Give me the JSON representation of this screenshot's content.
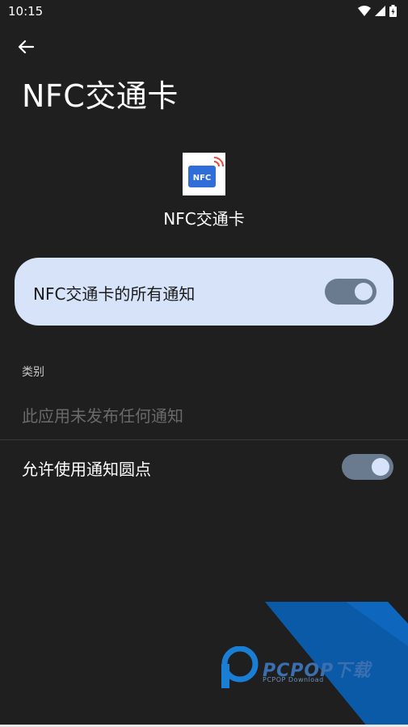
{
  "status_bar": {
    "time": "10:15",
    "icons": [
      "wifi-icon",
      "signal-icon",
      "battery-charging-icon"
    ]
  },
  "header": {
    "back_icon": "back-arrow-icon",
    "title": "NFC交通卡"
  },
  "app": {
    "icon_text": "NFC",
    "name": "NFC交通卡"
  },
  "all_notifications": {
    "label": "NFC交通卡的所有通知",
    "enabled": true
  },
  "category": {
    "heading": "类别",
    "empty_text": "此应用未发布任何通知"
  },
  "notification_dot": {
    "label": "允许使用通知圆点",
    "enabled": true
  },
  "watermark": {
    "brand": "PCPOP下载",
    "sub": "PCPOP Download"
  },
  "colors": {
    "background": "#1f1f1f",
    "card": "#d6e3f8",
    "toggle_track": "#6b7b8f",
    "watermark_blue": "#0a5aa8"
  }
}
